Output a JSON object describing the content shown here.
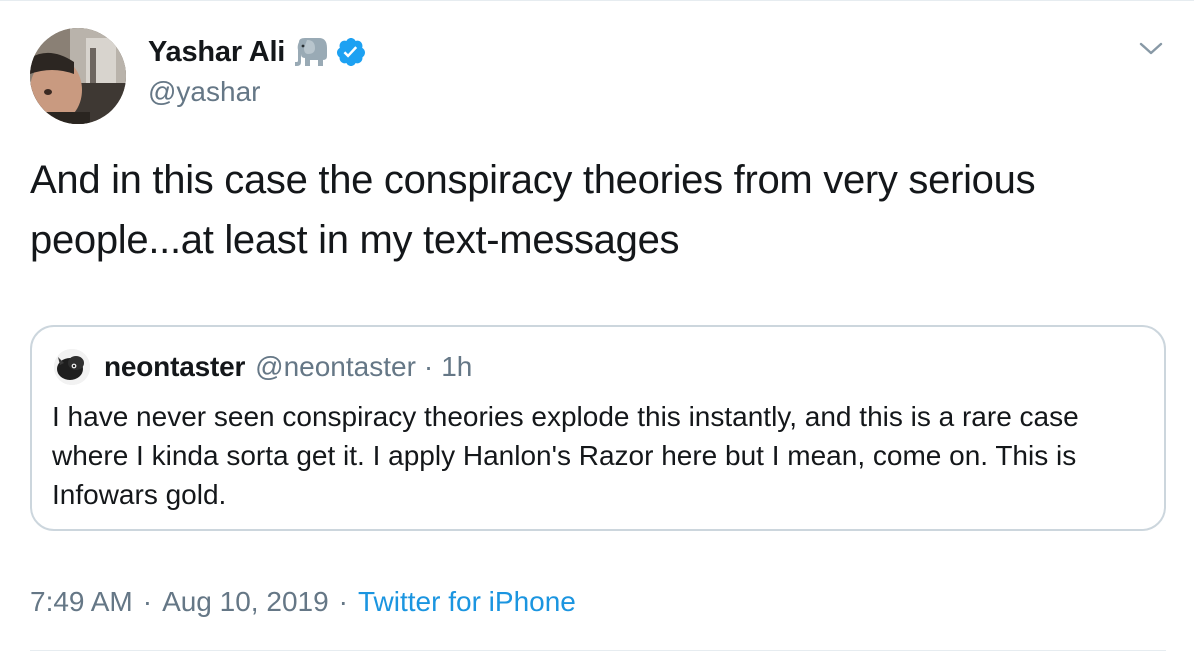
{
  "author": {
    "display_name": "Yashar Ali",
    "handle": "@yashar",
    "avatar_icon": "profile-photo",
    "badge_emoji_icon": "elephant-icon",
    "verified_icon": "verified-badge-icon"
  },
  "tweet": {
    "text": "And in this case the conspiracy theories from very serious people...at least in my text-messages"
  },
  "quoted_tweet": {
    "display_name": "neontaster",
    "handle": "@neontaster",
    "separator": "·",
    "time": "1h",
    "text": "I have never seen conspiracy theories explode this instantly, and this is a rare case where I kinda sorta get it. I apply Hanlon's Razor here but I mean, come on. This is Infowars gold."
  },
  "meta": {
    "time": "7:49 AM",
    "separator": "·",
    "date": "Aug 10, 2019",
    "source": "Twitter for iPhone"
  },
  "colors": {
    "text_primary": "#14171a",
    "text_secondary": "#657786",
    "link_blue": "#1b95e0",
    "verified_blue": "#1da1f2",
    "border": "#ccd6dd"
  }
}
